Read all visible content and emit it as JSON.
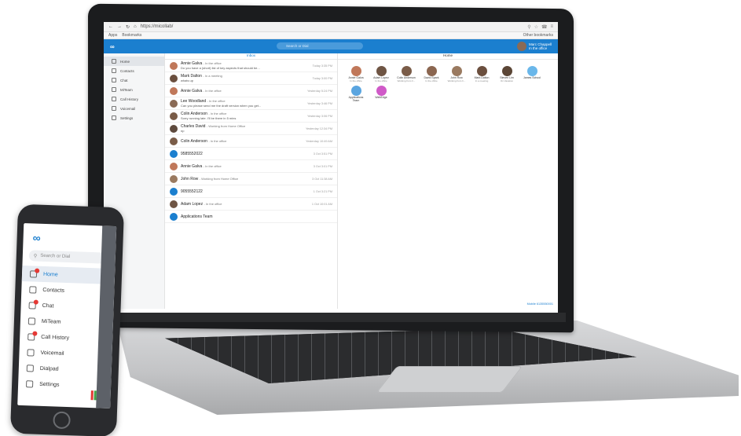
{
  "browser": {
    "url": "https://micollab/",
    "bookmarks": [
      "Apps",
      "Bookmarks"
    ],
    "other_bookmarks": "Other bookmarks"
  },
  "app": {
    "logo": "∞",
    "search_placeholder": "Search or Dial",
    "user_name": "Marc Chappell",
    "user_status": "In the office"
  },
  "sidebar": {
    "items": [
      {
        "label": "Home"
      },
      {
        "label": "Contacts"
      },
      {
        "label": "Chat"
      },
      {
        "label": "MiTeam"
      },
      {
        "label": "Call History"
      },
      {
        "label": "Voicemail"
      },
      {
        "label": "Settings"
      }
    ]
  },
  "inbox": {
    "title": "Inbox",
    "rows": [
      {
        "name": "Annie Galva",
        "status": "- In the office",
        "msg": "Do you have a (short) list of key aspects that should be...",
        "time": "Today 3:35 PM",
        "color": "#c0785a"
      },
      {
        "name": "Mark Dalton",
        "status": "- In a meeting",
        "msg": "whats up",
        "time": "Today 3:00 PM",
        "color": "#6b4f3e"
      },
      {
        "name": "Annie Galva",
        "status": "- In the office",
        "msg": "",
        "time": "Yesterday 5:24 PM",
        "color": "#c0785a"
      },
      {
        "name": "Lee Woodland",
        "status": "- In the office",
        "msg": "Can you please send me the draft version when you get...",
        "time": "Yesterday 3:46 PM",
        "color": "#8a6a55"
      },
      {
        "name": "Colin Anderson",
        "status": "- In the office",
        "msg": "Sorry running late. I'll be there in 5 mins",
        "time": "Yesterday 3:06 PM",
        "color": "#7a5c48"
      },
      {
        "name": "Charles David",
        "status": "- Working from Home Office",
        "msg": "np",
        "time": "Yesterday 12:34 PM",
        "color": "#5e4a3d"
      },
      {
        "name": "Colin Anderson",
        "status": "- In the office",
        "msg": "",
        "time": "Yesterday 10:49 AM",
        "color": "#7a5c48"
      },
      {
        "name": "9585552022",
        "status": "",
        "msg": "",
        "time": "3 Oct 3:51 PM",
        "color": "#1b7fcf"
      },
      {
        "name": "Annie Galva",
        "status": "- In the office",
        "msg": "",
        "time": "3 Oct 3:01 PM",
        "color": "#c0785a"
      },
      {
        "name": "John Row",
        "status": "- Working from Home Office",
        "msg": "",
        "time": "3 Oct 11:38 AM",
        "color": "#9a7a60"
      },
      {
        "name": "9055552122",
        "status": "",
        "msg": "",
        "time": "1 Oct 3:21 PM",
        "color": "#1b7fcf"
      },
      {
        "name": "Adam Lopez",
        "status": "- In the office",
        "msg": "",
        "time": "1 Oct 10:01 AM",
        "color": "#6f5544"
      },
      {
        "name": "Applications Team",
        "status": "",
        "msg": "",
        "time": "",
        "color": "#1b7fcf"
      }
    ]
  },
  "home": {
    "title": "Home",
    "tiles": [
      {
        "name": "Annie Galva",
        "sub": "In the office",
        "color": "#c0785a"
      },
      {
        "name": "Adam Lopez",
        "sub": "In the office",
        "color": "#6f5544"
      },
      {
        "name": "Colin Anderson",
        "sub": "Working from h...",
        "color": "#7a5c48"
      },
      {
        "name": "David Spark",
        "sub": "In the office",
        "color": "#8b6650"
      },
      {
        "name": "John Row",
        "sub": "Working from h...",
        "color": "#9a7a60"
      },
      {
        "name": "Mark Dalton",
        "sub": "In a meeting",
        "color": "#6b4f3e"
      },
      {
        "name": "Steven Lim",
        "sub": "On Vacation",
        "color": "#5b4636"
      },
      {
        "name": "James School",
        "sub": "",
        "color": "#6ab7ea"
      },
      {
        "name": "Applications Team",
        "sub": "",
        "color": "#5aa5e0"
      },
      {
        "name": "WebEdge",
        "sub": "",
        "color": "#d05ac8"
      }
    ],
    "footer": "Mobile 6135550001"
  },
  "phone": {
    "logo": "∞",
    "search_placeholder": "Search or Dial",
    "nav": [
      {
        "label": "Home"
      },
      {
        "label": "Contacts"
      },
      {
        "label": "Chat"
      },
      {
        "label": "MiTeam"
      },
      {
        "label": "Call History"
      },
      {
        "label": "Voicemail"
      },
      {
        "label": "Dialpad"
      },
      {
        "label": "Settings"
      }
    ]
  }
}
